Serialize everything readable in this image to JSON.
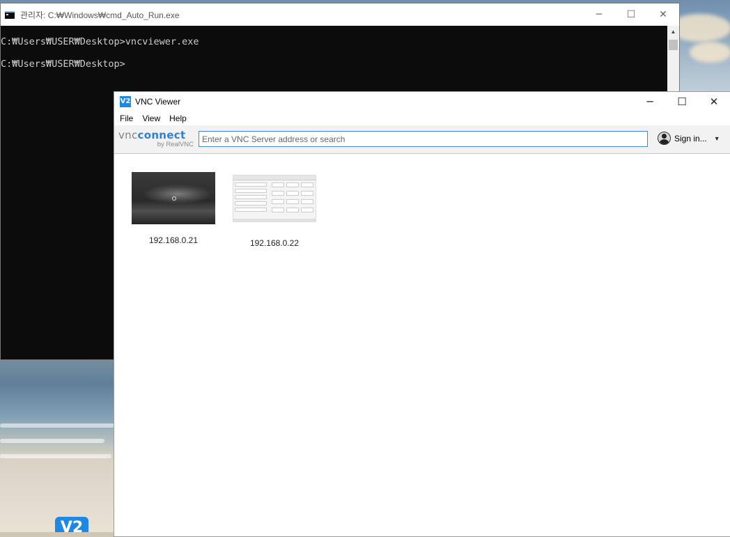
{
  "cmd": {
    "title": "관리자: C:₩Windows₩cmd_Auto_Run.exe",
    "lines": [
      "C:₩Users₩USER₩Desktop>vncviewer.exe",
      "C:₩Users₩USER₩Desktop>"
    ]
  },
  "vnc": {
    "title": "VNC Viewer",
    "icon_text": "V2",
    "menu": [
      "File",
      "View",
      "Help"
    ],
    "logo": {
      "vnc": "vnc",
      "connect": "connect",
      "by": "by RealVNC"
    },
    "search": {
      "value": "",
      "placeholder": "Enter a VNC Server address or search"
    },
    "signin_label": "Sign in...",
    "connections": [
      {
        "label": "192.168.0.21",
        "thumbnail": "dark-desktop"
      },
      {
        "label": "192.168.0.22",
        "thumbnail": "keypad-app"
      }
    ]
  },
  "taskbar": {
    "vnc_icon_text": "V2"
  },
  "icons": {
    "minimize": "─",
    "maximize": "☐",
    "close": "✕",
    "dropdown": "▼",
    "scroll_up": "▲"
  }
}
